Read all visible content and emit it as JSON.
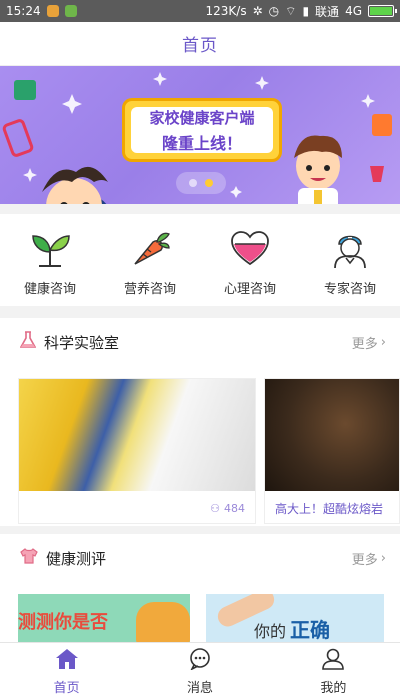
{
  "status_bar": {
    "time": "15:24",
    "speed": "123K/s",
    "carrier": "联通",
    "network": "4G"
  },
  "header": {
    "title": "首页"
  },
  "banner": {
    "line1": "家校健康客户端",
    "line2": "隆重上线！",
    "active_dot": 2
  },
  "categories": [
    {
      "label": "健康咨询",
      "icon": "sprout-icon"
    },
    {
      "label": "营养咨询",
      "icon": "carrot-icon"
    },
    {
      "label": "心理咨询",
      "icon": "heart-icon"
    },
    {
      "label": "专家咨询",
      "icon": "doctor-icon"
    }
  ],
  "science_lab": {
    "title": "科学实验室",
    "more": "更多",
    "cards": [
      {
        "caption": "",
        "views": "484"
      },
      {
        "caption": "高大上！超酷炫熔岩",
        "views": ""
      }
    ]
  },
  "health_eval": {
    "title": "健康测评",
    "more": "更多",
    "cards": [
      {
        "text": "测测你是否"
      },
      {
        "text_prefix": "你的",
        "text_highlight": "正确"
      }
    ]
  },
  "tabbar": [
    {
      "label": "首页",
      "active": true
    },
    {
      "label": "消息",
      "active": false
    },
    {
      "label": "我的",
      "active": false
    }
  ],
  "colors": {
    "accent": "#6b58c8",
    "banner": "#a98ef0"
  }
}
